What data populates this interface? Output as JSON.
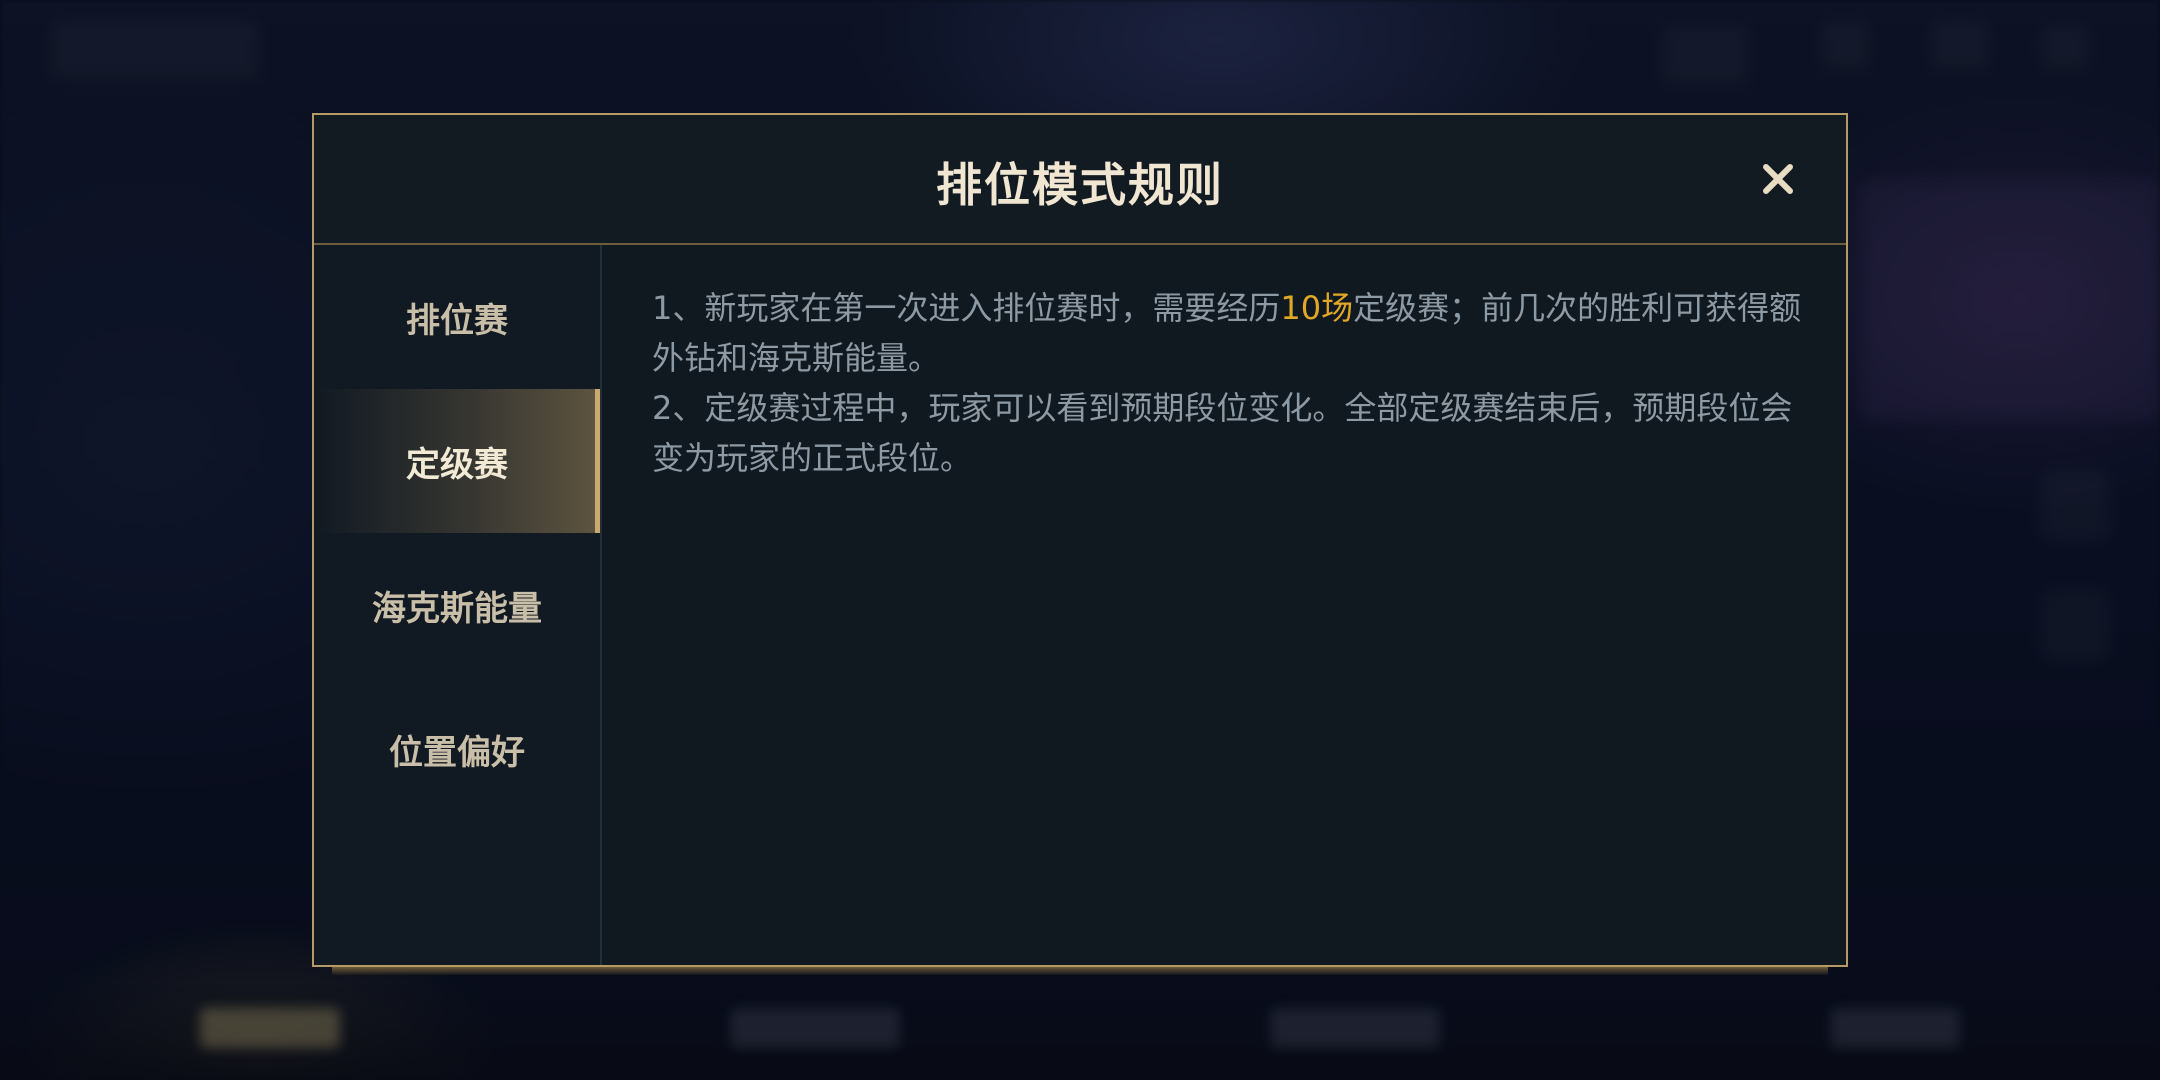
{
  "modal": {
    "title": "排位模式规则",
    "close_icon": "close-icon"
  },
  "sidebar": {
    "tabs": [
      {
        "label": "排位赛",
        "active": false
      },
      {
        "label": "定级赛",
        "active": true
      },
      {
        "label": "海克斯能量",
        "active": false
      },
      {
        "label": "位置偏好",
        "active": false
      }
    ]
  },
  "content": {
    "p1_prefix": "1、新玩家在第一次进入排位赛时，需要经历",
    "p1_highlight": "10场",
    "p1_suffix": "定级赛；前几次的胜利可获得额外钻和海克斯能量。",
    "p2": "2、定级赛过程中，玩家可以看到预期段位变化。全部定级赛结束后，预期段位会变为玩家的正式段位。"
  },
  "colors": {
    "accent_gold": "#c8aa6e",
    "highlight": "#e0a825",
    "body_text": "#8e9aa3",
    "title_text": "#f0e6d2"
  }
}
